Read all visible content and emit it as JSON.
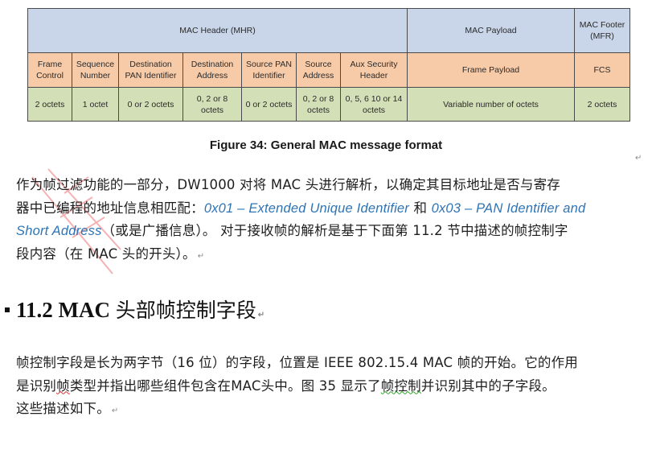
{
  "table": {
    "groups": [
      {
        "label": "MAC Header (MHR)",
        "span": 7
      },
      {
        "label": "MAC Payload",
        "span": 1
      },
      {
        "label": "MAC Footer (MFR)",
        "span": 1
      }
    ],
    "fields": [
      {
        "name": "Frame Control",
        "size": "2 octets"
      },
      {
        "name": "Sequence Number",
        "size": "1 octet"
      },
      {
        "name": "Destination PAN Identifier",
        "size": "0 or 2 octets"
      },
      {
        "name": "Destination Address",
        "size": "0, 2 or 8 octets"
      },
      {
        "name": "Source PAN Identifier",
        "size": "0 or 2 octets"
      },
      {
        "name": "Source Address",
        "size": "0, 2 or 8 octets"
      },
      {
        "name": "Aux Security Header",
        "size": "0, 5, 6 10 or 14 octets"
      },
      {
        "name": "Frame Payload",
        "size": "Variable number of octets"
      },
      {
        "name": "FCS",
        "size": "2 octets"
      }
    ],
    "colors": {
      "group_row": "#c9d5e8",
      "field_row": "#f8cba8",
      "size_row": "#d3dfb6"
    }
  },
  "caption": "Figure 34: General MAC message format",
  "paragraph1": {
    "line1": "作为帧过滤功能的一部分，DW1000 对将 MAC 头进行解析，以确定其目标地址是否与寄存",
    "line2_prefix": "器中已编程的地址信息相匹配：",
    "link1": "0x01 – Extended Unique Identifier",
    "joiner": " 和 ",
    "link2a": "0x03 – PAN Identifier and",
    "link2b": "Short Address",
    "line3_rest": "（或是广播信息）。 对于接收帧的解析是基于下面第 11.2 节中描述的帧控制字",
    "line4": "段内容（在 MAC 头的开头）。",
    "link_color": "#2e74b5"
  },
  "heading": {
    "number": "11.2 MAC ",
    "title_cjk": "头部帧控制字段"
  },
  "paragraph2": {
    "line1": "帧控制字段是长为两字节（16 位）的字段，位置是 IEEE 802.15.4 MAC 帧的开始。它的作用",
    "line2_a": "是识别",
    "line2_b": "帧",
    "line2_c": "类型并指出哪些组件包含在MAC头中。图 35 显示了",
    "line2_d": "帧控制",
    "line2_e": "并识别其中的子字段。",
    "line3": "这些描述如下。"
  },
  "paragraph_mark": "↵"
}
